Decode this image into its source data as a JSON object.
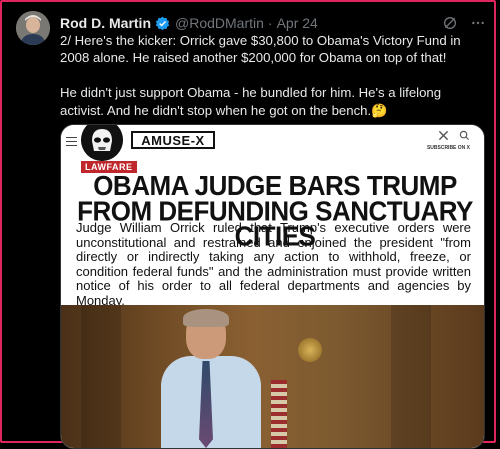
{
  "tweet": {
    "author_name": "Rod D. Martin",
    "handle": "@RodDMartin",
    "separator": "·",
    "date": "Apr 24",
    "paragraphs": [
      "2/ Here's the kicker: Orrick gave $30,800 to Obama's Victory Fund in 2008 alone. He raised another $200,000 for Obama on top of that!",
      "He didn't just support Obama - he bundled for him. He's a lifelong activist. And he didn't stop when he got on the bench.🤔"
    ]
  },
  "card": {
    "logo": "AMUSE-X",
    "subscribe_text": "SUBSCRIBE ON X",
    "tag": "LAWFARE",
    "headline": "OBAMA JUDGE BARS TRUMP FROM DEFUNDING SANCTUARY CITIES",
    "body": "Judge William Orrick ruled that Trump's executive orders were unconstitutional and restrained and enjoined the president \"from directly or indirectly taking any action to withhold, freeze, or condition federal funds\" and the administration must provide written notice of his order to all federal departments and agencies by Monday."
  },
  "icons": {
    "verified": "verified-badge-icon",
    "grok": "grok-icon",
    "more": "more-options-icon"
  },
  "colors": {
    "verified_blue": "#1d9bf0",
    "tag_red": "#c0272d",
    "frame_pink": "#e0245e"
  }
}
